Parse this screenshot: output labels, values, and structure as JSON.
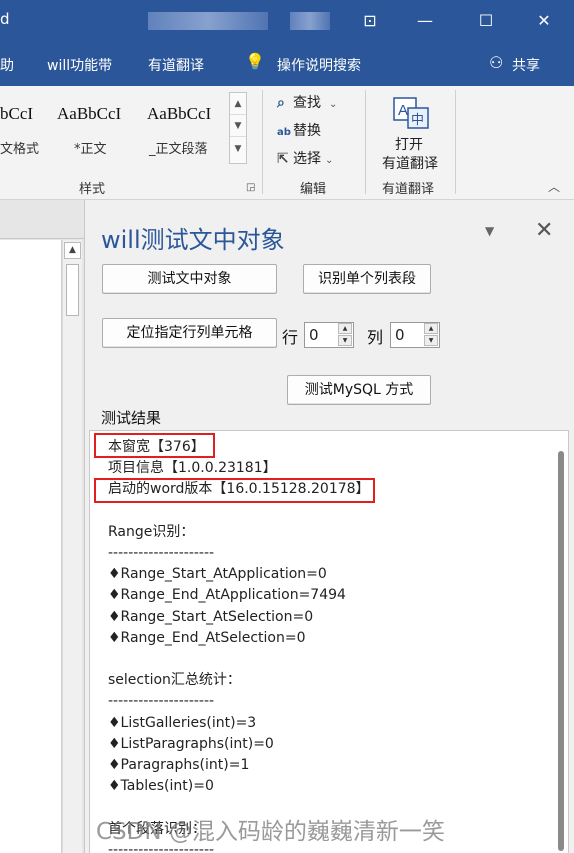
{
  "titlebar": {
    "title_fragment": "d",
    "controls": [
      "⊡",
      "—",
      "☐",
      "✕"
    ]
  },
  "menubar": {
    "items": [
      "助",
      "will功能带",
      "有道翻译",
      "操作说明搜索",
      "共享"
    ]
  },
  "ribbon": {
    "styles": [
      {
        "preview": "bCcI",
        "label": "文格式"
      },
      {
        "preview": "AaBbCcI",
        "label": "*正文"
      },
      {
        "preview": "AaBbCcI",
        "label": "_正文段落"
      }
    ],
    "styles_group": "样式",
    "edit": {
      "find": "查找",
      "replace": "替换",
      "select": "选择",
      "group": "编辑"
    },
    "youdao": {
      "open": "打开",
      "translate": "有道翻译",
      "group": "有道翻译"
    }
  },
  "pane": {
    "title": "will测试文中对象",
    "buttons": {
      "test_objects": "测试文中对象",
      "identify_col": "识别单个列表段",
      "locate_cell": "定位指定行列单元格",
      "test_mysql": "测试MySQL 方式"
    },
    "row_label": "行",
    "row_value": "0",
    "col_label": "列",
    "col_value": "0",
    "result_label": "测试结果",
    "result_lines": [
      "本窗宽【376】",
      "项目信息【1.0.0.23181】",
      "启动的word版本【16.0.15128.20178】",
      "",
      "Range识别：",
      "---------------------",
      "♦Range_Start_AtApplication=0",
      "♦Range_End_AtApplication=7494",
      "♦Range_Start_AtSelection=0",
      "♦Range_End_AtSelection=0",
      "",
      "selection汇总统计：",
      "---------------------",
      "♦ListGalleries(int)=3",
      "♦ListParagraphs(int)=0",
      "♦Paragraphs(int)=1",
      "♦Tables(int)=0",
      "",
      "首个段落识别：",
      "---------------------"
    ]
  },
  "watermark": "CSDN @混入码龄的巍巍清新一笑"
}
